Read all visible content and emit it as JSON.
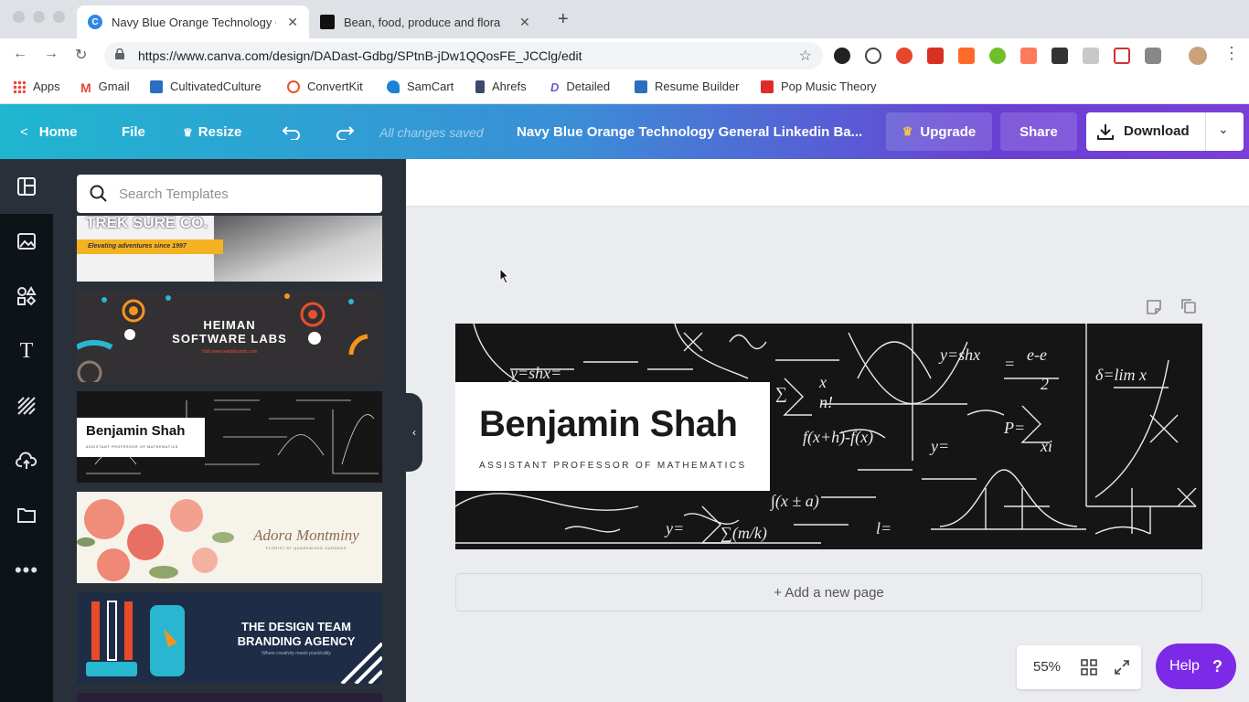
{
  "browser": {
    "tabs": [
      {
        "title": "Navy Blue Orange Technology General Linkedin Banner",
        "active": true
      },
      {
        "title": "Bean, food, produce and flora",
        "active": false
      }
    ],
    "url": "https://www.canva.com/design/DADast-Gdbg/SPtnB-jDw1QQosFE_JCClg/edit",
    "bookmarks": [
      "Apps",
      "Gmail",
      "CultivatedCulture",
      "ConvertKit",
      "SamCart",
      "Ahrefs",
      "Detailed",
      "Resume Builder",
      "Pop Music Theory"
    ]
  },
  "toolbar": {
    "home": "Home",
    "file": "File",
    "resize": "Resize",
    "saved_status": "All changes saved",
    "doc_title": "Navy Blue Orange Technology General Linkedin Ba...",
    "upgrade": "Upgrade",
    "share": "Share",
    "download": "Download"
  },
  "sidebar": {
    "search_placeholder": "Search Templates",
    "templates": [
      {
        "title": "TREK SURE CO.",
        "subtitle": "Elevating adventures since 1997"
      },
      {
        "title": "HEIMAN SOFTWARE LABS",
        "subtitle": "Visit www.realtybrands.com"
      },
      {
        "title": "Benjamin Shah",
        "subtitle": "ASSISTANT PROFESSOR OF MATHEMATICS"
      },
      {
        "title": "Adora Montminy",
        "subtitle": "FLORIST AT QUARKWOOD GARDENS"
      },
      {
        "title": "THE DESIGN TEAM BRANDING AGENCY",
        "subtitle": "Where creativity meets practicality"
      }
    ]
  },
  "canvas": {
    "name": "Benjamin Shah",
    "role": "ASSISTANT PROFESSOR OF MATHEMATICS",
    "add_page": "+ Add a new page",
    "zoom": "55%",
    "help": "Help",
    "help_glyph": "?"
  },
  "colors": {
    "toolbar_start": "#1fb6d0",
    "toolbar_end": "#7b3fd8",
    "help_purple": "#7d2ae8",
    "rail_dark": "#0e1318",
    "panel_dark": "#293039"
  }
}
